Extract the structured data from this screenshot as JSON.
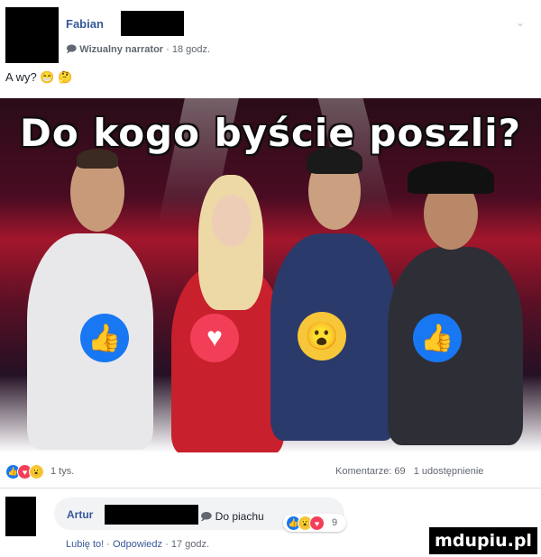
{
  "post": {
    "author_name": "Fabian",
    "author_badge": "Wizualny narrator",
    "time": "18 godz.",
    "text": "A wy?",
    "headline": "Do kogo byście poszli?"
  },
  "reactions": {
    "count": "1 tys.",
    "comments": "Komentarze: 69",
    "shares": "1 udostępnienie"
  },
  "comment": {
    "author_name": "Artur",
    "badge_text": "Do piachu",
    "reaction_count": "9",
    "like": "Lubię to!",
    "reply": "Odpowiedz",
    "time": "17 godz."
  },
  "watermark": "mdupiu.pl",
  "colors": {
    "like_blue": "#1877f2",
    "love_red": "#f33e58",
    "wow_yellow": "#f7c739",
    "link_blue": "#365899"
  }
}
